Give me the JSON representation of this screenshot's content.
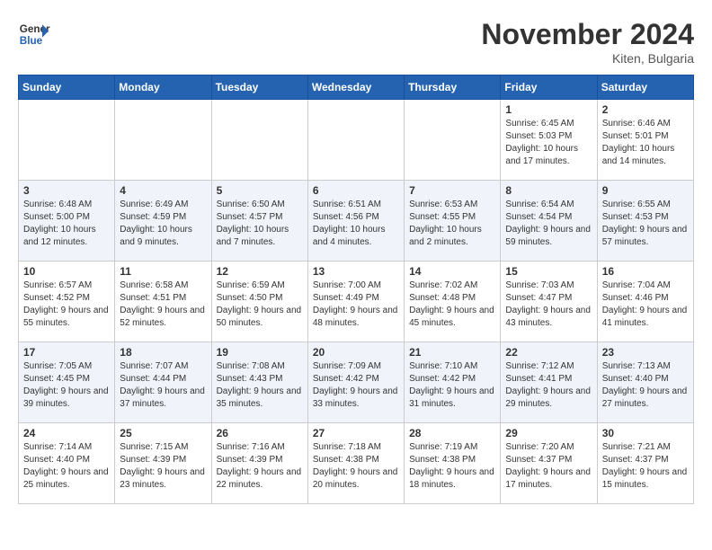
{
  "header": {
    "logo_line1": "General",
    "logo_line2": "Blue",
    "month": "November 2024",
    "location": "Kiten, Bulgaria"
  },
  "days_of_week": [
    "Sunday",
    "Monday",
    "Tuesday",
    "Wednesday",
    "Thursday",
    "Friday",
    "Saturday"
  ],
  "weeks": [
    [
      {
        "num": "",
        "info": ""
      },
      {
        "num": "",
        "info": ""
      },
      {
        "num": "",
        "info": ""
      },
      {
        "num": "",
        "info": ""
      },
      {
        "num": "",
        "info": ""
      },
      {
        "num": "1",
        "info": "Sunrise: 6:45 AM\nSunset: 5:03 PM\nDaylight: 10 hours and 17 minutes."
      },
      {
        "num": "2",
        "info": "Sunrise: 6:46 AM\nSunset: 5:01 PM\nDaylight: 10 hours and 14 minutes."
      }
    ],
    [
      {
        "num": "3",
        "info": "Sunrise: 6:48 AM\nSunset: 5:00 PM\nDaylight: 10 hours and 12 minutes."
      },
      {
        "num": "4",
        "info": "Sunrise: 6:49 AM\nSunset: 4:59 PM\nDaylight: 10 hours and 9 minutes."
      },
      {
        "num": "5",
        "info": "Sunrise: 6:50 AM\nSunset: 4:57 PM\nDaylight: 10 hours and 7 minutes."
      },
      {
        "num": "6",
        "info": "Sunrise: 6:51 AM\nSunset: 4:56 PM\nDaylight: 10 hours and 4 minutes."
      },
      {
        "num": "7",
        "info": "Sunrise: 6:53 AM\nSunset: 4:55 PM\nDaylight: 10 hours and 2 minutes."
      },
      {
        "num": "8",
        "info": "Sunrise: 6:54 AM\nSunset: 4:54 PM\nDaylight: 9 hours and 59 minutes."
      },
      {
        "num": "9",
        "info": "Sunrise: 6:55 AM\nSunset: 4:53 PM\nDaylight: 9 hours and 57 minutes."
      }
    ],
    [
      {
        "num": "10",
        "info": "Sunrise: 6:57 AM\nSunset: 4:52 PM\nDaylight: 9 hours and 55 minutes."
      },
      {
        "num": "11",
        "info": "Sunrise: 6:58 AM\nSunset: 4:51 PM\nDaylight: 9 hours and 52 minutes."
      },
      {
        "num": "12",
        "info": "Sunrise: 6:59 AM\nSunset: 4:50 PM\nDaylight: 9 hours and 50 minutes."
      },
      {
        "num": "13",
        "info": "Sunrise: 7:00 AM\nSunset: 4:49 PM\nDaylight: 9 hours and 48 minutes."
      },
      {
        "num": "14",
        "info": "Sunrise: 7:02 AM\nSunset: 4:48 PM\nDaylight: 9 hours and 45 minutes."
      },
      {
        "num": "15",
        "info": "Sunrise: 7:03 AM\nSunset: 4:47 PM\nDaylight: 9 hours and 43 minutes."
      },
      {
        "num": "16",
        "info": "Sunrise: 7:04 AM\nSunset: 4:46 PM\nDaylight: 9 hours and 41 minutes."
      }
    ],
    [
      {
        "num": "17",
        "info": "Sunrise: 7:05 AM\nSunset: 4:45 PM\nDaylight: 9 hours and 39 minutes."
      },
      {
        "num": "18",
        "info": "Sunrise: 7:07 AM\nSunset: 4:44 PM\nDaylight: 9 hours and 37 minutes."
      },
      {
        "num": "19",
        "info": "Sunrise: 7:08 AM\nSunset: 4:43 PM\nDaylight: 9 hours and 35 minutes."
      },
      {
        "num": "20",
        "info": "Sunrise: 7:09 AM\nSunset: 4:42 PM\nDaylight: 9 hours and 33 minutes."
      },
      {
        "num": "21",
        "info": "Sunrise: 7:10 AM\nSunset: 4:42 PM\nDaylight: 9 hours and 31 minutes."
      },
      {
        "num": "22",
        "info": "Sunrise: 7:12 AM\nSunset: 4:41 PM\nDaylight: 9 hours and 29 minutes."
      },
      {
        "num": "23",
        "info": "Sunrise: 7:13 AM\nSunset: 4:40 PM\nDaylight: 9 hours and 27 minutes."
      }
    ],
    [
      {
        "num": "24",
        "info": "Sunrise: 7:14 AM\nSunset: 4:40 PM\nDaylight: 9 hours and 25 minutes."
      },
      {
        "num": "25",
        "info": "Sunrise: 7:15 AM\nSunset: 4:39 PM\nDaylight: 9 hours and 23 minutes."
      },
      {
        "num": "26",
        "info": "Sunrise: 7:16 AM\nSunset: 4:39 PM\nDaylight: 9 hours and 22 minutes."
      },
      {
        "num": "27",
        "info": "Sunrise: 7:18 AM\nSunset: 4:38 PM\nDaylight: 9 hours and 20 minutes."
      },
      {
        "num": "28",
        "info": "Sunrise: 7:19 AM\nSunset: 4:38 PM\nDaylight: 9 hours and 18 minutes."
      },
      {
        "num": "29",
        "info": "Sunrise: 7:20 AM\nSunset: 4:37 PM\nDaylight: 9 hours and 17 minutes."
      },
      {
        "num": "30",
        "info": "Sunrise: 7:21 AM\nSunset: 4:37 PM\nDaylight: 9 hours and 15 minutes."
      }
    ]
  ]
}
